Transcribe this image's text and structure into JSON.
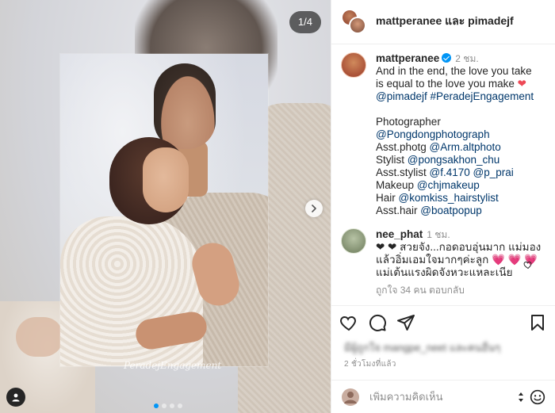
{
  "media": {
    "counter": "1/4",
    "watermark": "PeradejEngagement",
    "page_dots": 4,
    "active_dot": 0
  },
  "header": {
    "title": "mattperanee และ pimadejf"
  },
  "caption": {
    "username": "mattperanee",
    "time": "2 ชม.",
    "text_line1": "And in the end, the love you take is equal to the love you make ",
    "heart": "❤",
    "mention": "@pimadejf",
    "hashtag": "#PeradejEngagement",
    "credits": [
      {
        "label": "Photographer",
        "handle": ""
      },
      {
        "label": "",
        "handle": "@Pongdongphotograph"
      },
      {
        "label": "Asst.photg ",
        "handle": "@Arm.altphoto"
      },
      {
        "label": "Stylist ",
        "handle": "@pongsakhon_chu"
      },
      {
        "label": "Asst.stylist ",
        "handle": "@f.4170",
        "handle2": "@p_prai"
      },
      {
        "label": "Makeup ",
        "handle": "@chjmakeup"
      },
      {
        "label": "Hair ",
        "handle": "@komkiss_hairstylist"
      },
      {
        "label": "Asst.hair ",
        "handle": "@boatpopup"
      }
    ]
  },
  "comment2": {
    "username": "nee_phat",
    "time": "1 ชม.",
    "text": "❤ ❤ สวยจัง...กอดอบอุ่นมาก แม่มองแล้วอิ่มเอมใจมากๆค่ะลูก 💗 💗 💗 แม่เต้นแรงผิดจังหวะแหละเนีย",
    "replies": "ถูกใจ 34 คน   ตอบกลับ"
  },
  "likes": {
    "text": "มีผู้ถูกใจ mangpe_neet และคนอื่นๆ"
  },
  "time_ago": "2 ชั่วโมงที่แล้ว",
  "composer": {
    "placeholder": "เพิ่มความคิดเห็น"
  },
  "colors": {
    "accent": "#0095f6",
    "link": "#00376b",
    "heart": "#ed4956",
    "muted": "#8e8e8e"
  }
}
